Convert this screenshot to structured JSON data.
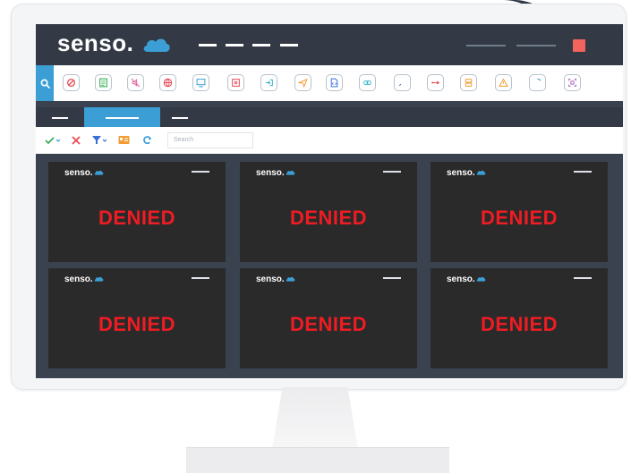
{
  "app": {
    "brand": "senso.",
    "colors": {
      "accent": "#3b9fd6",
      "dark": "#333a45",
      "screen": "#3a4250",
      "tile": "#2a2a2a",
      "denied": "#ee1c23",
      "close": "#f4645f"
    }
  },
  "toolbar": {
    "search_icon": "search-icon",
    "icons": [
      {
        "name": "block-icon",
        "color": "#e94b57"
      },
      {
        "name": "checklist-icon",
        "color": "#3cae5b"
      },
      {
        "name": "mute-icon",
        "color": "#e06ba2"
      },
      {
        "name": "globe-icon",
        "color": "#e94b57"
      },
      {
        "name": "remote-screen-icon",
        "color": "#3b9fd6"
      },
      {
        "name": "close-window-icon",
        "color": "#e94b57"
      },
      {
        "name": "login-icon",
        "color": "#36b7c7"
      },
      {
        "name": "send-icon",
        "color": "#f39c33"
      },
      {
        "name": "file-code-icon",
        "color": "#3b6fd6"
      },
      {
        "name": "link-icon",
        "color": "#36b7c7"
      },
      {
        "name": "rocket-icon",
        "color": "#3b6fd6"
      },
      {
        "name": "usb-icon",
        "color": "#e94b57"
      },
      {
        "name": "server-icon",
        "color": "#f39c33"
      },
      {
        "name": "warning-icon",
        "color": "#f39c33"
      },
      {
        "name": "shield-icon",
        "color": "#3b9fd6"
      },
      {
        "name": "scan-icon",
        "color": "#9b59b6"
      }
    ]
  },
  "actions": {
    "search_placeholder": "Search"
  },
  "tiles": [
    {
      "brand": "senso.",
      "status": "DENIED"
    },
    {
      "brand": "senso.",
      "status": "DENIED"
    },
    {
      "brand": "senso.",
      "status": "DENIED"
    },
    {
      "brand": "senso.",
      "status": "DENIED"
    },
    {
      "brand": "senso.",
      "status": "DENIED"
    },
    {
      "brand": "senso.",
      "status": "DENIED"
    }
  ]
}
